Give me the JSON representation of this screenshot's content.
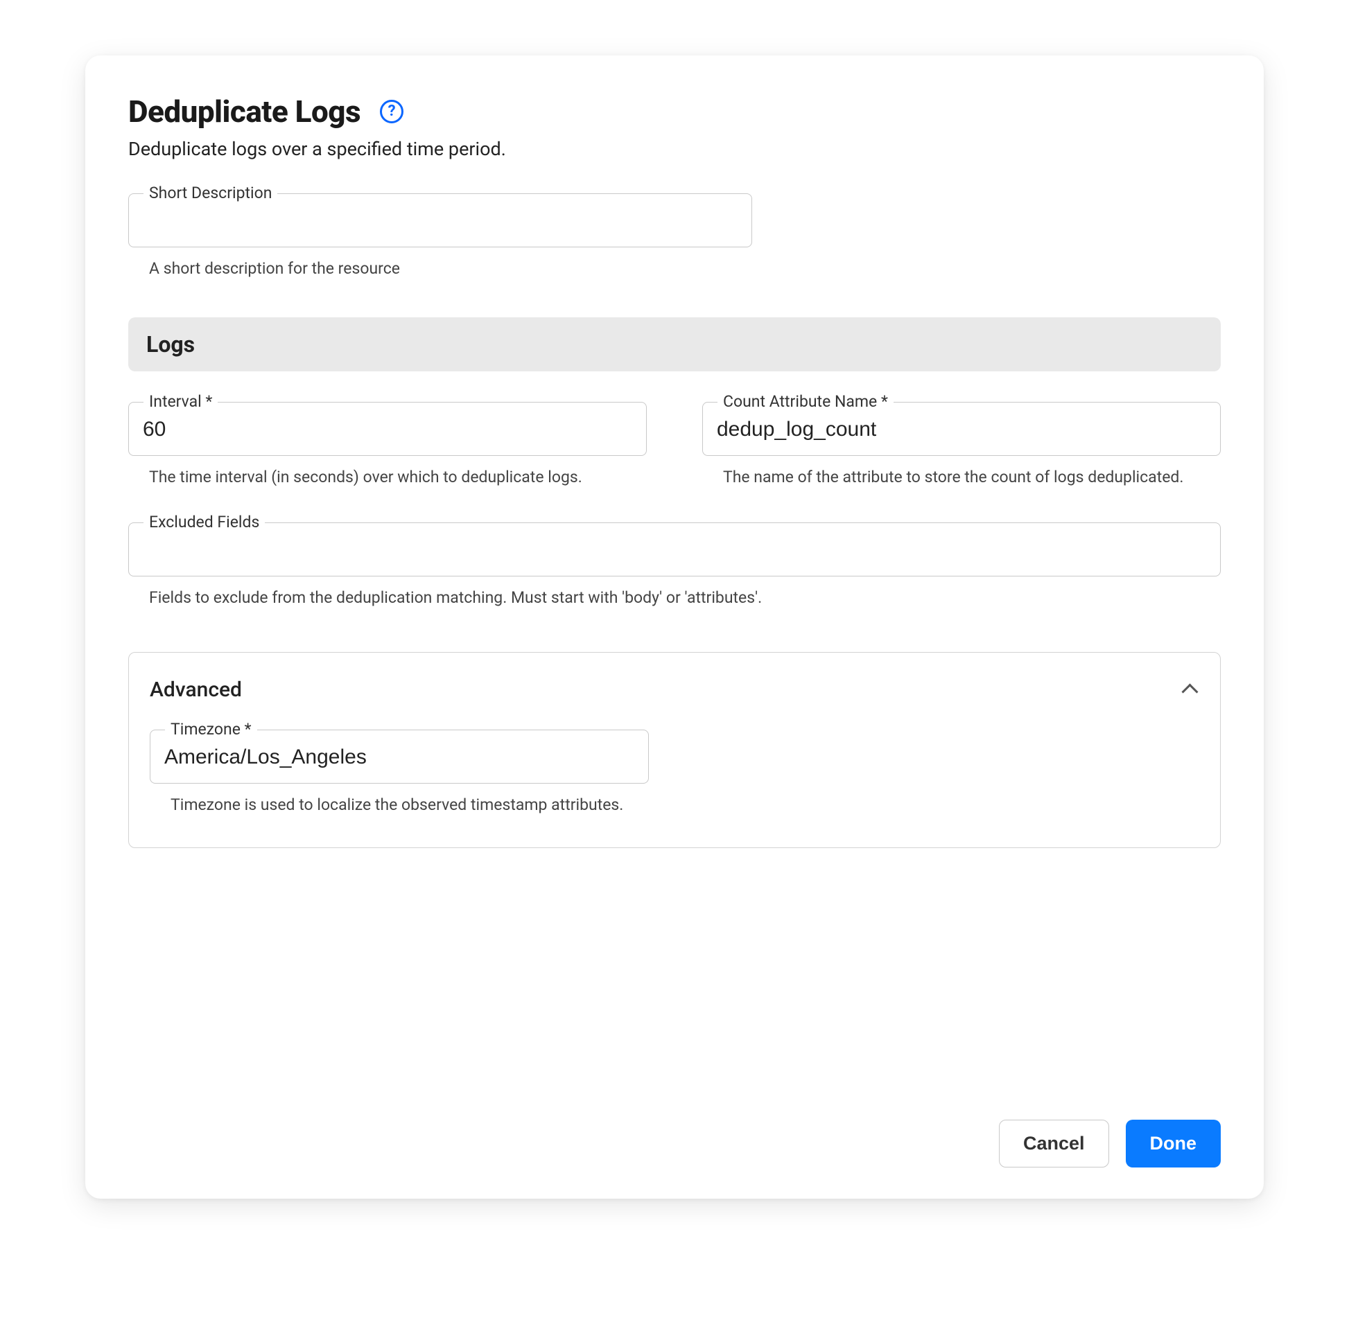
{
  "header": {
    "title": "Deduplicate Logs",
    "subtitle": "Deduplicate logs over a specified time period.",
    "help_icon": "help-circle-icon"
  },
  "fields": {
    "short_description": {
      "label": "Short Description",
      "value": "",
      "helper": "A short description for the resource"
    }
  },
  "sections": {
    "logs": {
      "title": "Logs",
      "interval": {
        "label": "Interval *",
        "value": "60",
        "helper": "The time interval (in seconds) over which to deduplicate logs."
      },
      "count_attr": {
        "label": "Count Attribute Name *",
        "value": "dedup_log_count",
        "helper": "The name of the attribute to store the count of logs deduplicated."
      },
      "excluded_fields": {
        "label": "Excluded Fields",
        "value": "",
        "helper": "Fields to exclude from the deduplication matching. Must start with 'body' or 'attributes'."
      }
    },
    "advanced": {
      "title": "Advanced",
      "expanded": true,
      "timezone": {
        "label": "Timezone *",
        "value": "America/Los_Angeles",
        "helper": "Timezone is used to localize the observed timestamp attributes."
      }
    }
  },
  "footer": {
    "cancel": "Cancel",
    "done": "Done"
  }
}
